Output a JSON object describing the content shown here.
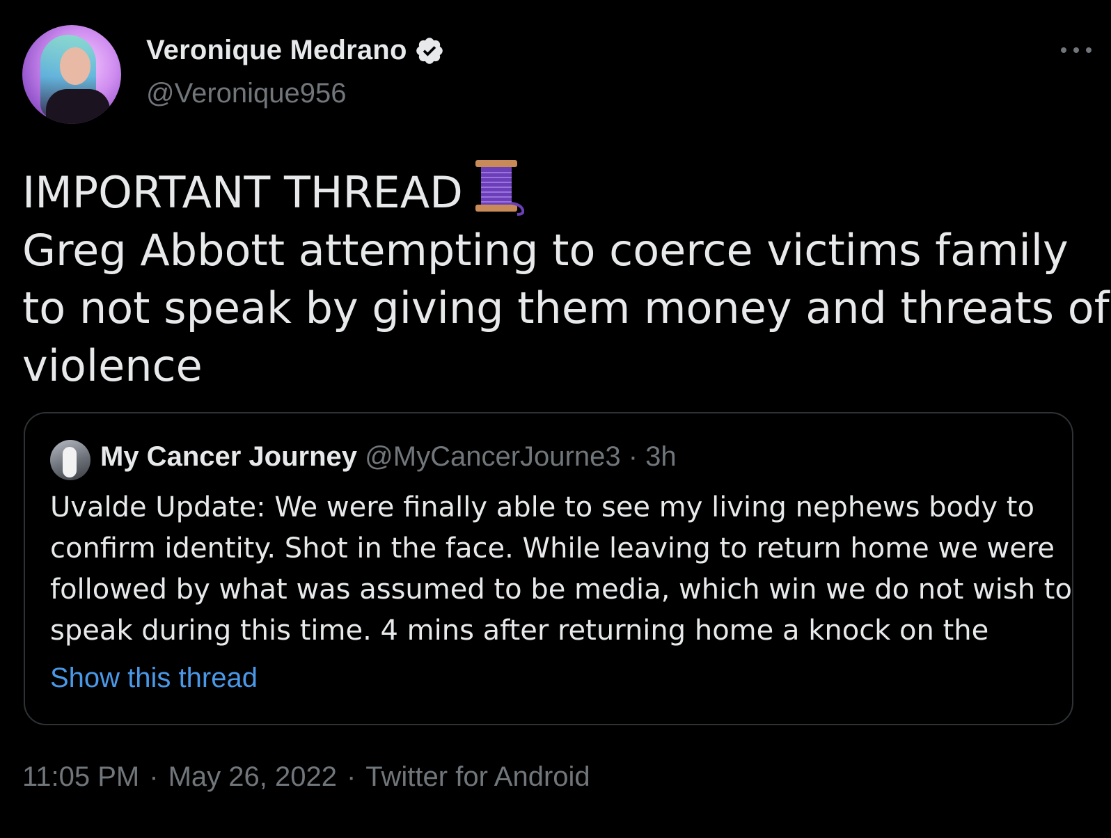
{
  "author": {
    "display_name": "Veronique Medrano",
    "handle": "@Veronique956",
    "verified": true,
    "avatar_icon": "profile-photo"
  },
  "tweet": {
    "lines": [
      "IMPORTANT THREAD",
      "Greg Abbott attempting to coerce victims family",
      "to not speak by giving them money and threats of",
      "violence"
    ],
    "emoji_icon": "thread-spool-icon"
  },
  "quoted_tweet": {
    "display_name": "My Cancer Journey",
    "handle": "@MyCancerJourne3",
    "separator": "·",
    "time": "3h",
    "lines": [
      "Uvalde Update: We were finally able to see my living nephews body to",
      "confirm identity. Shot in the face. While leaving to return home we were",
      "followed by what was assumed to be media, which win we do not wish to",
      "speak during this time. 4 mins after returning home a knock on the"
    ],
    "show_thread_label": "Show this thread"
  },
  "footer": {
    "time": "11:05 PM",
    "separator": "·",
    "date": "May 26, 2022",
    "source": "Twitter for Android"
  },
  "colors": {
    "background": "#000000",
    "primary_text": "#e7e9ea",
    "secondary_text": "#71767b",
    "link": "#4a99e9",
    "border": "#2f3336",
    "spool": "#7b4fc9"
  }
}
